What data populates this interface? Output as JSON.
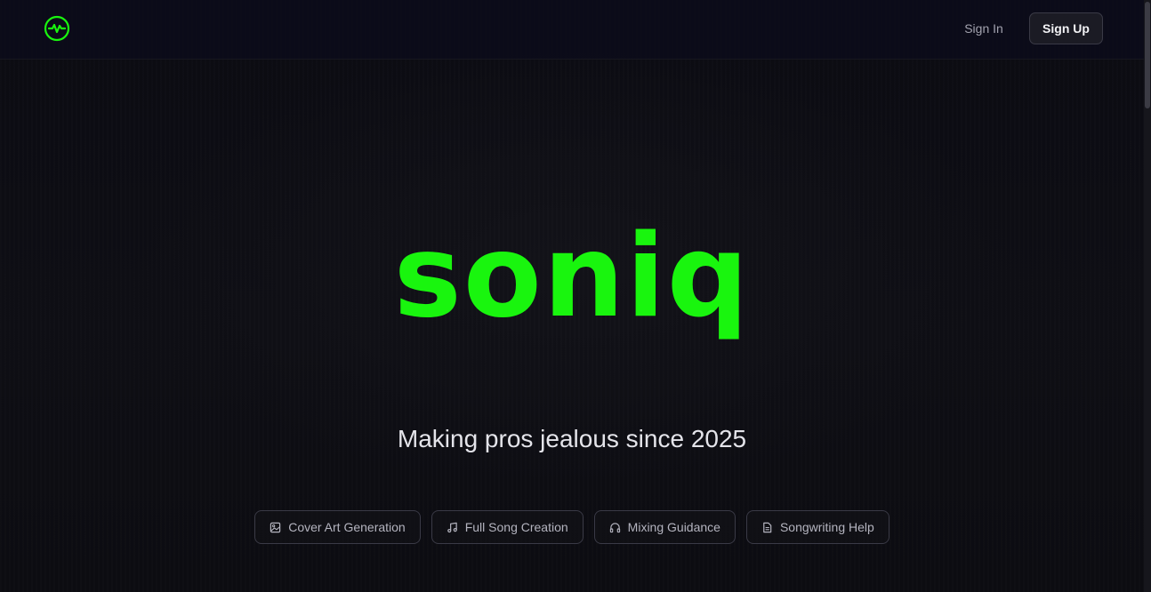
{
  "header": {
    "logo_icon": "waveform-circle-icon",
    "sign_in_label": "Sign In",
    "sign_up_label": "Sign Up"
  },
  "hero": {
    "wordmark": "soniq",
    "tagline": "Making pros jealous since 2025"
  },
  "features": [
    {
      "label": "Cover Art Generation",
      "icon": "image-icon"
    },
    {
      "label": "Full Song Creation",
      "icon": "music-note-icon"
    },
    {
      "label": "Mixing Guidance",
      "icon": "headphones-icon"
    },
    {
      "label": "Songwriting Help",
      "icon": "document-icon"
    }
  ],
  "colors": {
    "accent": "#19f50e",
    "background": "#0c0c12",
    "chip_border": "#3a3a46"
  }
}
